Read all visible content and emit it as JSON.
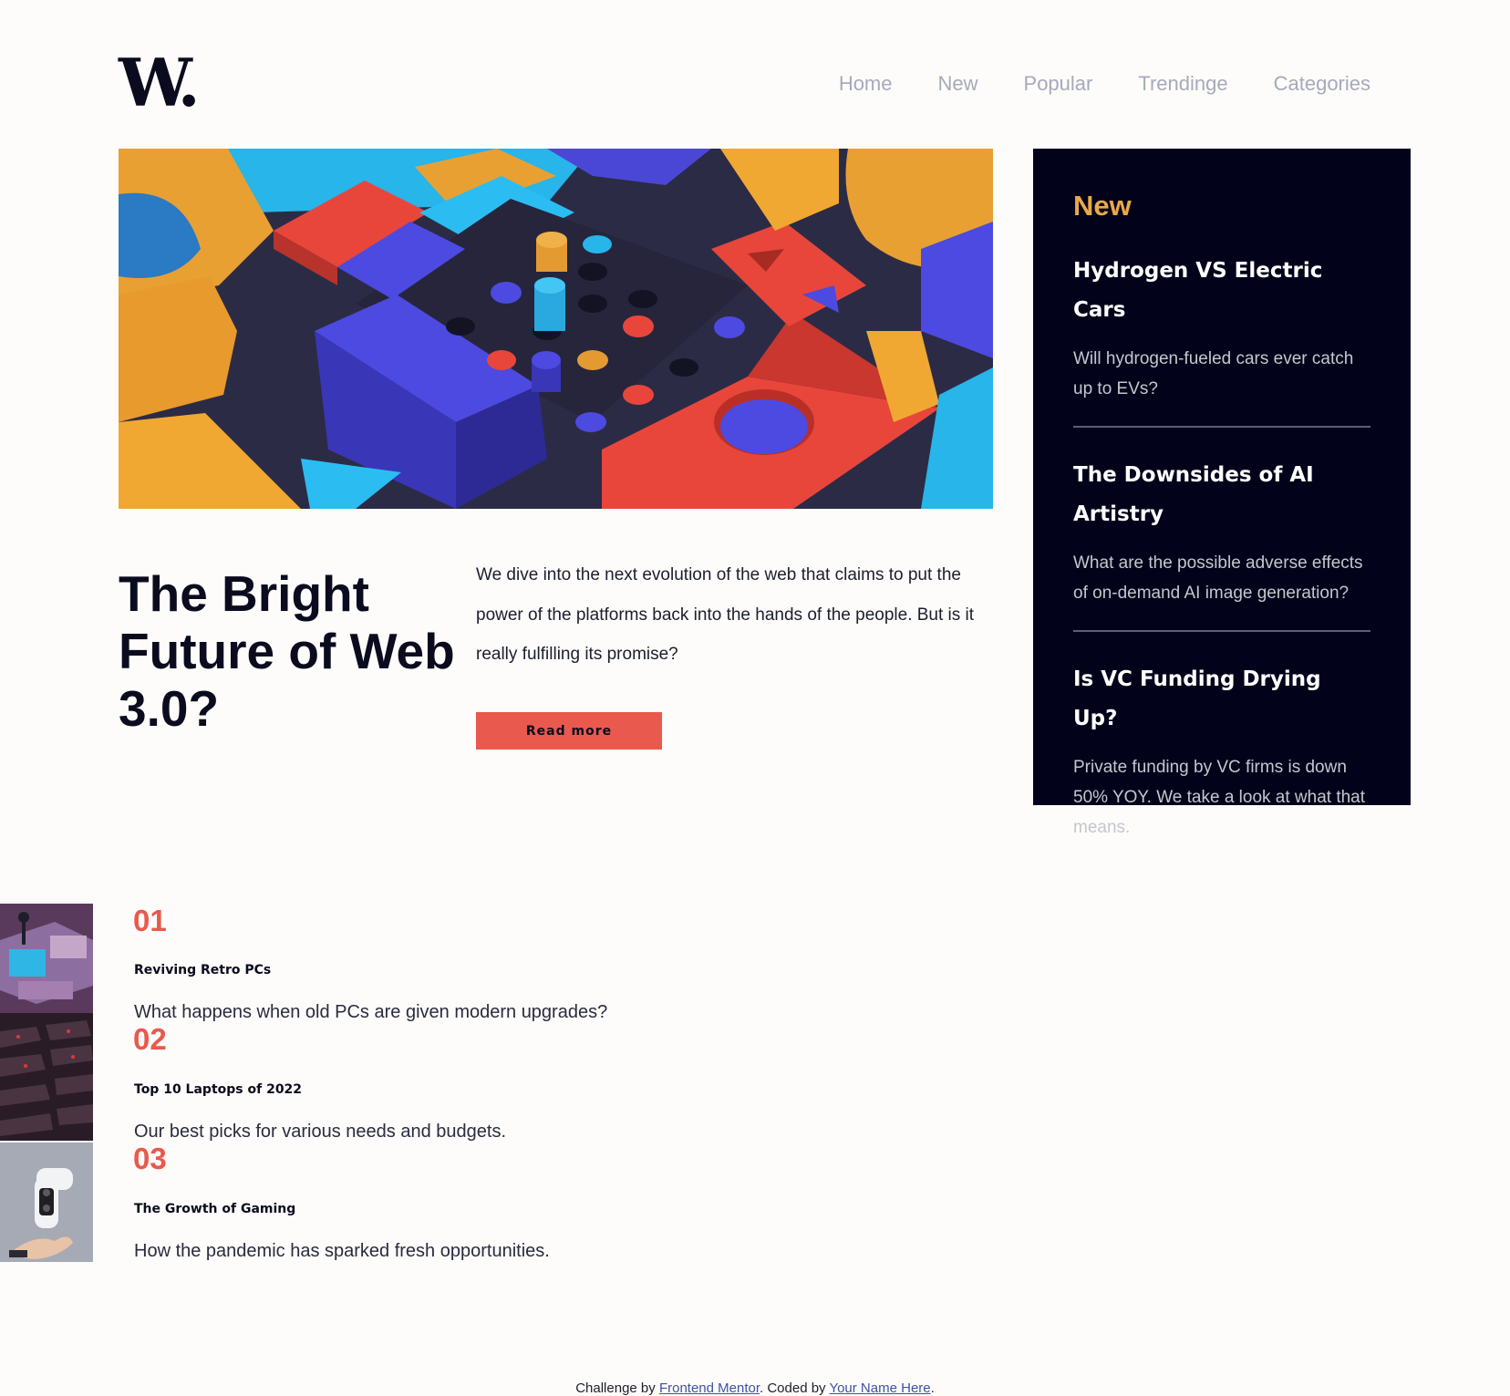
{
  "header": {
    "logo": "W.",
    "nav": [
      "Home",
      "New",
      "Popular",
      "Trendinge",
      "Categories"
    ]
  },
  "hero": {
    "title": "The Bright Future of Web 3.0?",
    "description": "We dive into the next evolution of the web that claims to put the power of the platforms back into the hands of the people. But is it really fulfilling its promise?",
    "button_label": "Read more"
  },
  "sidebar": {
    "heading": "New",
    "items": [
      {
        "title": "Hydrogen VS Electric Cars",
        "description": "Will hydrogen-fueled cars ever catch up to EVs?"
      },
      {
        "title": "The Downsides of AI Artistry",
        "description": "What are the possible adverse effects of on-demand AI image generation?"
      },
      {
        "title": "Is VC Funding Drying Up?",
        "description": "Private funding by VC firms is down 50% YOY. We take a look at what that means."
      }
    ]
  },
  "list": [
    {
      "number": "01",
      "title": "Reviving Retro PCs",
      "description": "What happens when old PCs are given modern upgrades?"
    },
    {
      "number": "02",
      "title": "Top 10 Laptops of 2022",
      "description": "Our best picks for various needs and budgets."
    },
    {
      "number": "03",
      "title": "The Growth of Gaming",
      "description": "How the pandemic has sparked fresh opportunities."
    }
  ],
  "footer": {
    "prefix": "Challenge by ",
    "link1": "Frontend Mentor",
    "middle": ". Coded by ",
    "link2": "Your Name Here",
    "suffix": "."
  },
  "colors": {
    "accent_red": "#e9594d",
    "accent_orange": "#e9a848",
    "dark_navy": "#02031a",
    "nav_grey": "#a7a9bd"
  }
}
